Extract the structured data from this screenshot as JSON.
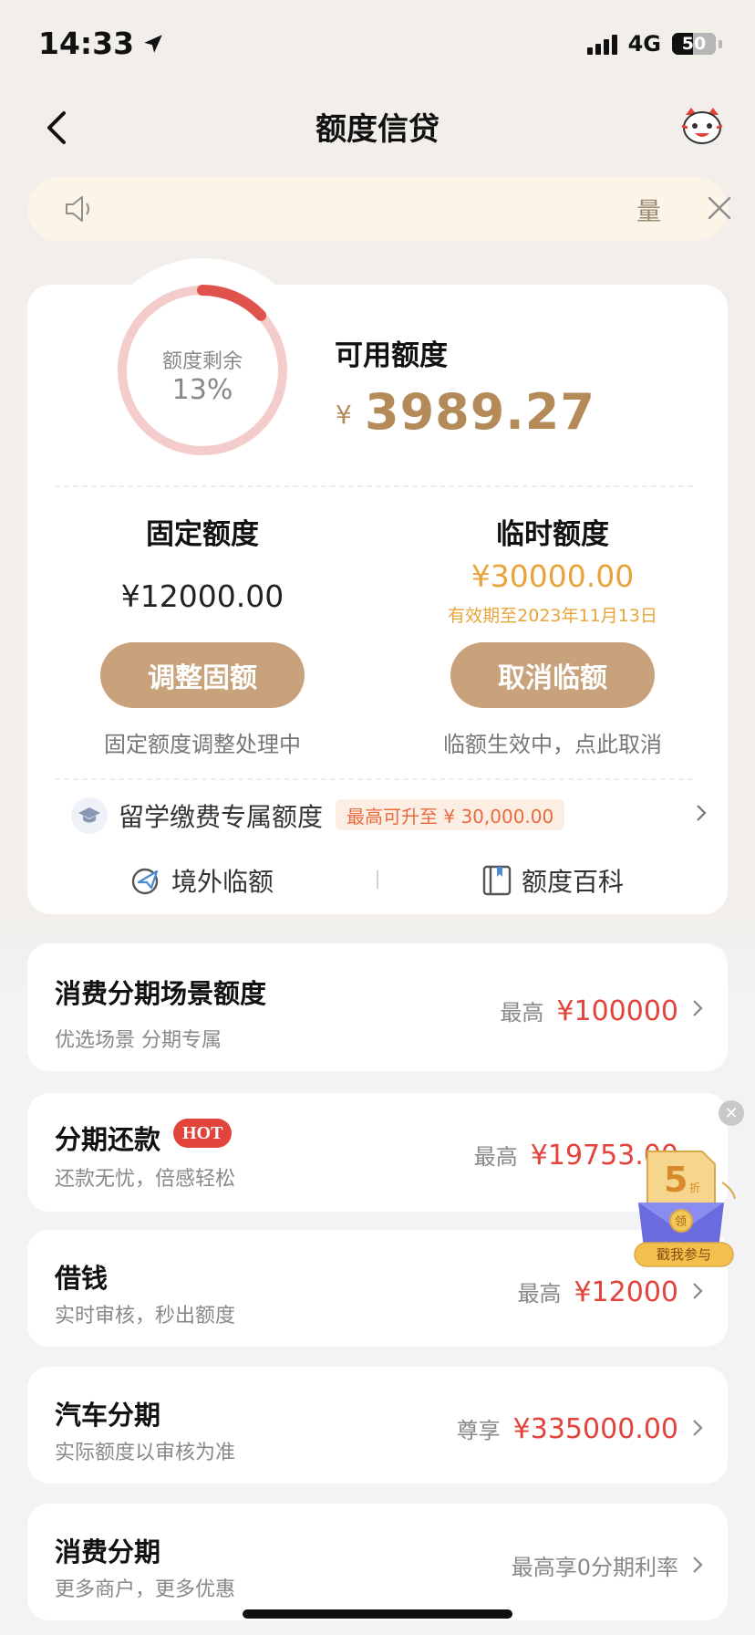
{
  "status": {
    "time": "14:33",
    "network": "4G",
    "battery": "50"
  },
  "nav": {
    "title": "额度信贷"
  },
  "notice": {
    "text": "量"
  },
  "credit": {
    "ring_label": "额度剩余",
    "ring_percent": "13%",
    "ring_fraction": 0.13,
    "available_label": "可用额度",
    "currency": "¥",
    "available_amount": "3989.27",
    "fixed": {
      "title": "固定额度",
      "amount": "¥12000.00",
      "button": "调整固额",
      "note": "固定额度调整处理中"
    },
    "temp": {
      "title": "临时额度",
      "amount": "¥30000.00",
      "valid": "有效期至2023年11月13日",
      "button": "取消临额",
      "note": "临额生效中，点此取消"
    },
    "study": {
      "label": "留学缴费专属额度",
      "badge": "最高可升至 ¥ 30,000.00"
    },
    "links": {
      "overseas": "境外临额",
      "wiki": "额度百科"
    }
  },
  "list": [
    {
      "title": "消费分期场景额度",
      "subtitle": "优选场景 分期专属",
      "prefix": "最高",
      "amount": "¥100000"
    },
    {
      "title": "分期还款",
      "badge": "HOT",
      "subtitle": "还款无忧，倍感轻松",
      "prefix": "最高",
      "amount": "¥19753.00"
    },
    {
      "title": "借钱",
      "subtitle": "实时审核，秒出额度",
      "prefix": "最高",
      "amount": "¥12000"
    },
    {
      "title": "汽车分期",
      "subtitle": "实际额度以审核为准",
      "prefix": "尊享",
      "amount": "¥335000.00"
    },
    {
      "title": "消费分期",
      "subtitle": "更多商户，更多优惠",
      "prefix": "最高享0分期利率",
      "amount": ""
    }
  ],
  "promo": {
    "number": "5",
    "unit": "折",
    "coin": "领",
    "cta": "戳我参与"
  },
  "colors": {
    "accent": "#c7a27a",
    "gold_text": "#b38a58",
    "red": "#e2433b",
    "orange": "#e8a43a"
  }
}
